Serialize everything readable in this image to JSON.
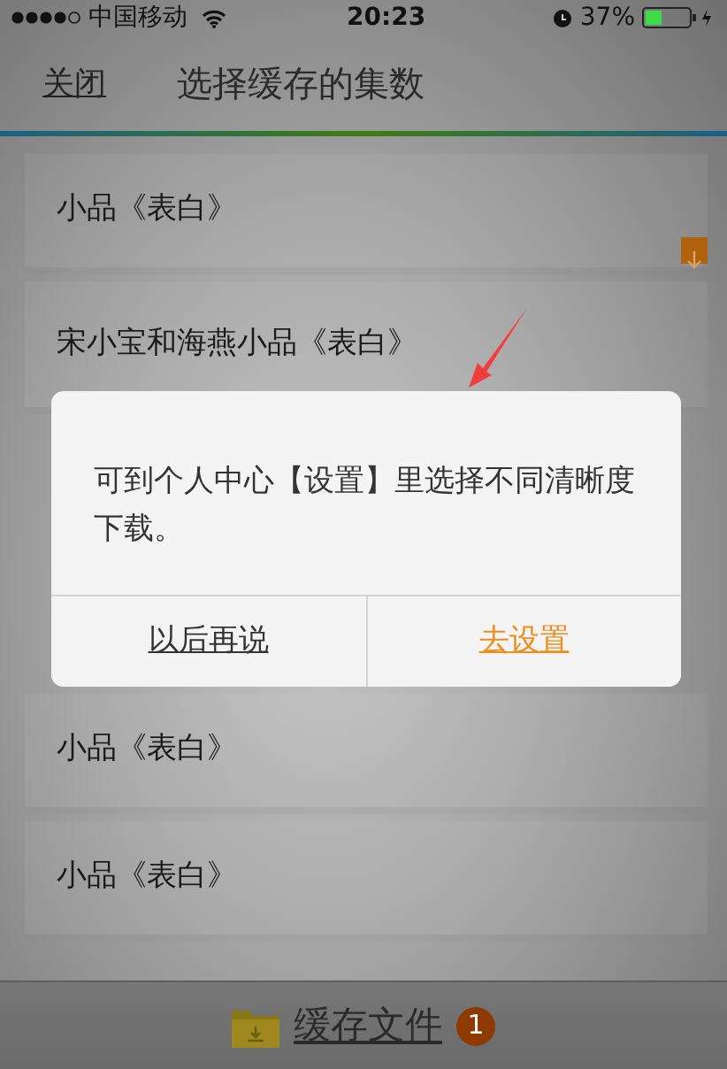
{
  "status_bar": {
    "carrier": "中国移动",
    "time": "20:23",
    "battery": "37%"
  },
  "nav": {
    "close": "关闭",
    "title": "选择缓存的集数"
  },
  "episodes": [
    {
      "title": "小品《表白》",
      "cached": true
    },
    {
      "title": "宋小宝和海燕小品《表白》",
      "cached": false
    },
    {
      "title": "小品《表白》",
      "cached": false
    },
    {
      "title": "小品《表白》",
      "cached": false
    }
  ],
  "dialog": {
    "message": "可到个人中心【设置】里选择不同清晰度下载。",
    "buttons": [
      {
        "label": "以后再说",
        "kind": "cancel"
      },
      {
        "label": "去设置",
        "kind": "confirm"
      }
    ]
  },
  "bottom_bar": {
    "label": "缓存文件",
    "count": "1"
  }
}
